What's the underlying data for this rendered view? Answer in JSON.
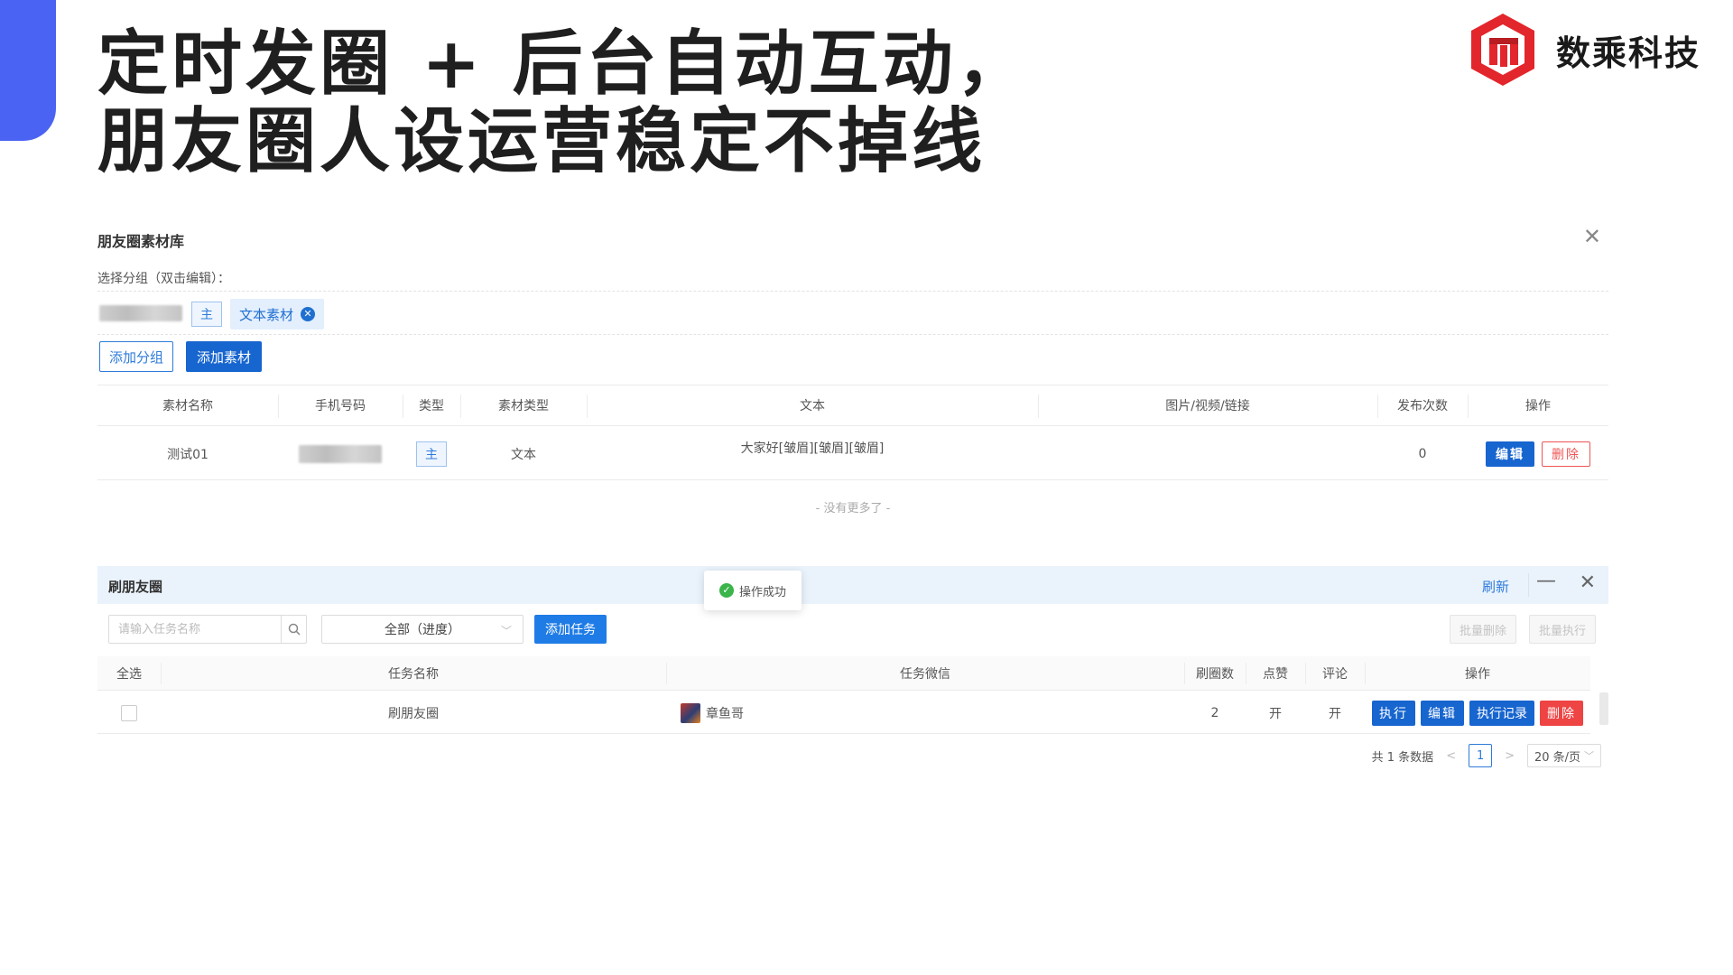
{
  "headline": {
    "line1": "定时发圈 + 后台自动互动，",
    "line2": "朋友圈人设运营稳定不掉线"
  },
  "brand": {
    "name": "数乘科技",
    "logo_color": "#e2262b"
  },
  "material_panel": {
    "title": "朋友圈素材库",
    "group_label": "选择分组（双击编辑）：",
    "group_tag": "主",
    "chip_label": "文本素材",
    "add_group_button": "添加分组",
    "add_material_button": "添加素材",
    "columns": [
      "素材名称",
      "手机号码",
      "类型",
      "素材类型",
      "文本",
      "图片/视频/链接",
      "发布次数",
      "操作"
    ],
    "row": {
      "name": "测试01",
      "type_tag": "主",
      "material_type": "文本",
      "text": "大家好[皱眉][皱眉][皱眉]",
      "publish_count": "0",
      "edit_button": "编辑",
      "delete_button": "删除"
    },
    "no_more": "- 没有更多了 -"
  },
  "task_panel": {
    "title": "刷朋友圈",
    "refresh": "刷新",
    "toast": "操作成功",
    "search_placeholder": "请输入任务名称",
    "filter_value": "全部（进度）",
    "add_task_button": "添加任务",
    "batch_delete": "批量删除",
    "batch_execute": "批量执行",
    "columns": [
      "全选",
      "任务名称",
      "任务微信",
      "刷圈数",
      "点赞",
      "评论",
      "操作"
    ],
    "row": {
      "task_name": "刷朋友圈",
      "wechat": "章鱼哥",
      "count": "2",
      "like": "开",
      "comment": "开",
      "execute": "执行",
      "edit": "编辑",
      "log": "执行记录",
      "delete": "删除"
    },
    "pagination": {
      "total": "共 1 条数据",
      "current": "1",
      "page_size": "20 条/页"
    }
  },
  "colors": {
    "accent": "#4a63f2",
    "primary": "#1765cf",
    "danger": "#ee4444"
  }
}
